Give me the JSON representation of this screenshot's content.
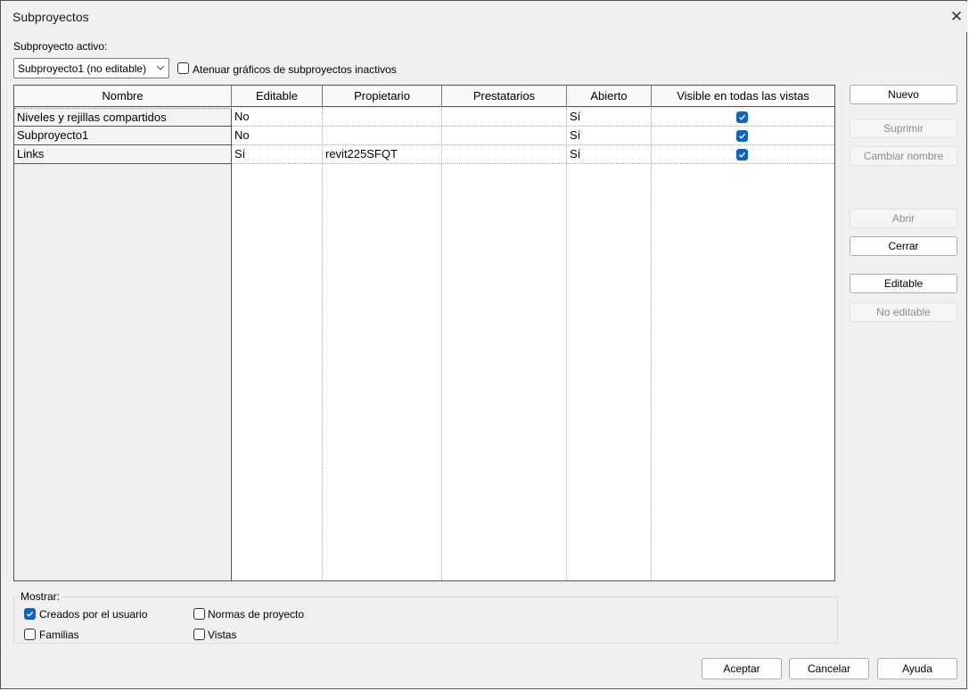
{
  "window": {
    "title": "Subproyectos"
  },
  "active": {
    "label": "Subproyecto activo:",
    "selected": "Subproyecto1 (no editable)",
    "dim_label": "Atenuar gráficos de subproyectos inactivos",
    "dim_checked": false
  },
  "table": {
    "columns": [
      "Nombre",
      "Editable",
      "Propietario",
      "Prestatarios",
      "Abierto",
      "Visible en todas las vistas"
    ],
    "rows": [
      {
        "name": "Niveles y rejillas compartidos",
        "editable": "No",
        "owner": "",
        "borrowers": "",
        "open": "Sí",
        "visible": true
      },
      {
        "name": "Subproyecto1",
        "editable": "No",
        "owner": "",
        "borrowers": "",
        "open": "Sí",
        "visible": true
      },
      {
        "name": "Links",
        "editable": "Sí",
        "owner": "revit225SFQT",
        "borrowers": "",
        "open": "Sí",
        "visible": true
      }
    ]
  },
  "side_buttons": {
    "new": "Nuevo",
    "delete": "Suprimir",
    "rename": "Cambiar nombre",
    "open": "Abrir",
    "close": "Cerrar",
    "editable": "Editable",
    "not_editable": "No editable"
  },
  "show": {
    "legend": "Mostrar:",
    "user_created": {
      "label": "Creados por el usuario",
      "checked": true
    },
    "families": {
      "label": "Familias",
      "checked": false
    },
    "project_standards": {
      "label": "Normas de proyecto",
      "checked": false
    },
    "views": {
      "label": "Vistas",
      "checked": false
    }
  },
  "footer": {
    "ok": "Aceptar",
    "cancel": "Cancelar",
    "help": "Ayuda"
  }
}
